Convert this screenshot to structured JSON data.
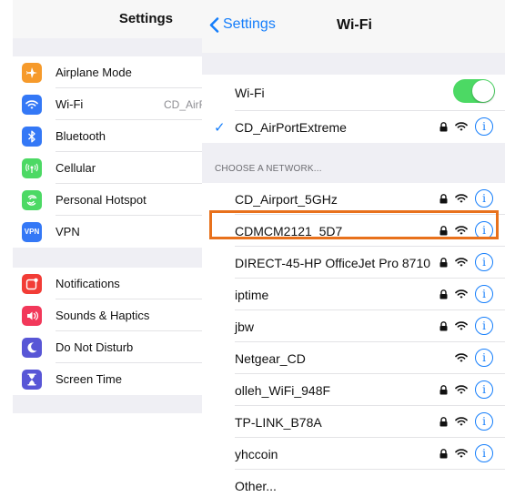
{
  "settings": {
    "title": "Settings",
    "group1": [
      {
        "label": "Airplane Mode",
        "icon": "airplane-icon",
        "color": "#f69a2b",
        "value": ""
      },
      {
        "label": "Wi-Fi",
        "icon": "wifi-icon",
        "color": "#3478f6",
        "value": "CD_AirF"
      },
      {
        "label": "Bluetooth",
        "icon": "bluetooth-icon",
        "color": "#3478f6",
        "value": ""
      },
      {
        "label": "Cellular",
        "icon": "cellular-icon",
        "color": "#4cd964",
        "value": ""
      },
      {
        "label": "Personal Hotspot",
        "icon": "hotspot-icon",
        "color": "#4cd964",
        "value": ""
      },
      {
        "label": "VPN",
        "icon": "vpn-icon",
        "color": "#3478f6",
        "value": ""
      }
    ],
    "group2": [
      {
        "label": "Notifications",
        "icon": "notifications-icon",
        "color": "#f23c36",
        "value": ""
      },
      {
        "label": "Sounds & Haptics",
        "icon": "sound-icon",
        "color": "#f2385a",
        "value": ""
      },
      {
        "label": "Do Not Disturb",
        "icon": "moon-icon",
        "color": "#5856d6",
        "value": ""
      },
      {
        "label": "Screen Time",
        "icon": "hourglass-icon",
        "color": "#5856d6",
        "value": ""
      }
    ],
    "vpn_icon_text": "VPN"
  },
  "wifi": {
    "back_label": "Settings",
    "title": "Wi-Fi",
    "toggle_label": "Wi-Fi",
    "toggle_on": true,
    "connected_network": "CD_AirPortExtreme",
    "section_header": "CHOOSE A NETWORK...",
    "networks": [
      {
        "name": "CD_Airport_5GHz",
        "locked": true
      },
      {
        "name": "CDMCM2121_5D7",
        "locked": true,
        "highlighted": true
      },
      {
        "name": "DIRECT-45-HP OfficeJet Pro 8710",
        "locked": true
      },
      {
        "name": "iptime",
        "locked": true
      },
      {
        "name": "jbw",
        "locked": true
      },
      {
        "name": "Netgear_CD",
        "locked": false
      },
      {
        "name": "olleh_WiFi_948F",
        "locked": true
      },
      {
        "name": "TP-LINK_B78A",
        "locked": true
      },
      {
        "name": "yhccoin",
        "locked": true
      }
    ],
    "other_label": "Other...",
    "info_glyph": "i"
  },
  "colors": {
    "accent": "#157efb",
    "toggle_on": "#4cd964",
    "highlight": "#e8711c",
    "group_bg": "#efeff4"
  }
}
